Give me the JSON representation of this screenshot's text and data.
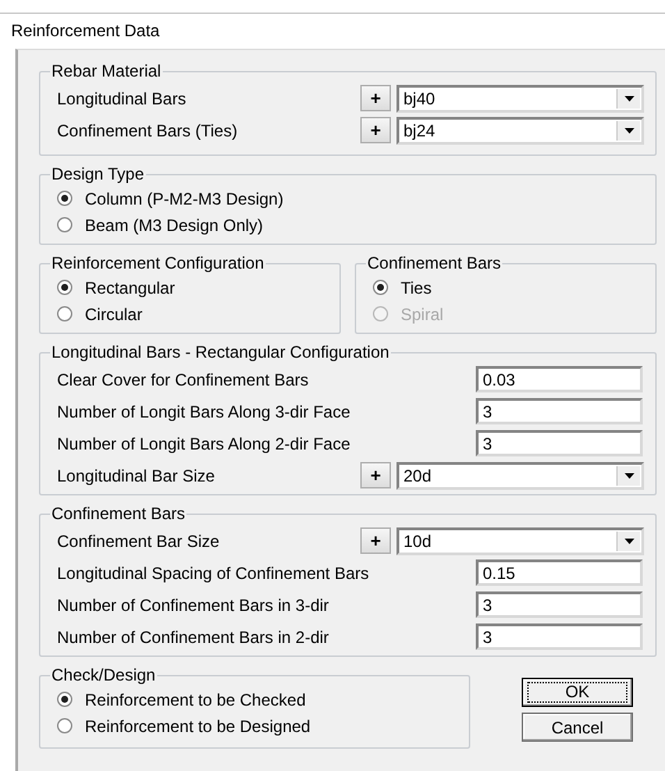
{
  "window": {
    "title": "Reinforcement Data"
  },
  "rebar_material": {
    "title": "Rebar Material",
    "rows": [
      {
        "kind": "dropdown",
        "label": "Longitudinal Bars",
        "button": "+",
        "value": "bj40"
      },
      {
        "kind": "dropdown",
        "label": "Confinement Bars  (Ties)",
        "button": "+",
        "value": "bj24"
      }
    ]
  },
  "design_type": {
    "title": "Design Type",
    "options": [
      {
        "label": "Column  (P-M2-M3 Design)",
        "selected": true,
        "disabled": false
      },
      {
        "label": "Beam  (M3 Design Only)",
        "selected": false,
        "disabled": false
      }
    ]
  },
  "reinforcement_configuration": {
    "title": "Reinforcement Configuration",
    "options": [
      {
        "label": "Rectangular",
        "selected": true,
        "disabled": false
      },
      {
        "label": "Circular",
        "selected": false,
        "disabled": false
      }
    ]
  },
  "confinement_type": {
    "title": "Confinement Bars",
    "options": [
      {
        "label": "Ties",
        "selected": true,
        "disabled": false
      },
      {
        "label": "Spiral",
        "selected": false,
        "disabled": true
      }
    ]
  },
  "longitudinal_bars": {
    "title": "Longitudinal Bars - Rectangular Configuration",
    "rows": [
      {
        "kind": "field",
        "label": "Clear Cover for Confinement Bars",
        "value": "0.03"
      },
      {
        "kind": "field",
        "label": "Number of Longit Bars Along 3-dir Face",
        "value": "3"
      },
      {
        "kind": "field",
        "label": "Number of Longit Bars Along 2-dir Face",
        "value": "3"
      },
      {
        "kind": "dropdown",
        "label": "Longitudinal Bar Size",
        "button": "+",
        "value": "20d"
      }
    ]
  },
  "confinement_bars": {
    "title": "Confinement Bars",
    "rows": [
      {
        "kind": "dropdown",
        "label": "Confinement Bar Size",
        "button": "+",
        "value": "10d"
      },
      {
        "kind": "field",
        "label": "Longitudinal Spacing of Confinement Bars",
        "value": "0.15"
      },
      {
        "kind": "field",
        "label": "Number of Confinement Bars in 3-dir",
        "value": "3"
      },
      {
        "kind": "field",
        "label": "Number of Confinement Bars in 2-dir",
        "value": "3"
      }
    ]
  },
  "check_design": {
    "title": "Check/Design",
    "options": [
      {
        "label": "Reinforcement to be Checked",
        "selected": true,
        "disabled": false
      },
      {
        "label": "Reinforcement to be Designed",
        "selected": false,
        "disabled": false
      }
    ]
  },
  "buttons": [
    {
      "label": "OK",
      "focused": true
    },
    {
      "label": "Cancel",
      "focused": false
    }
  ]
}
